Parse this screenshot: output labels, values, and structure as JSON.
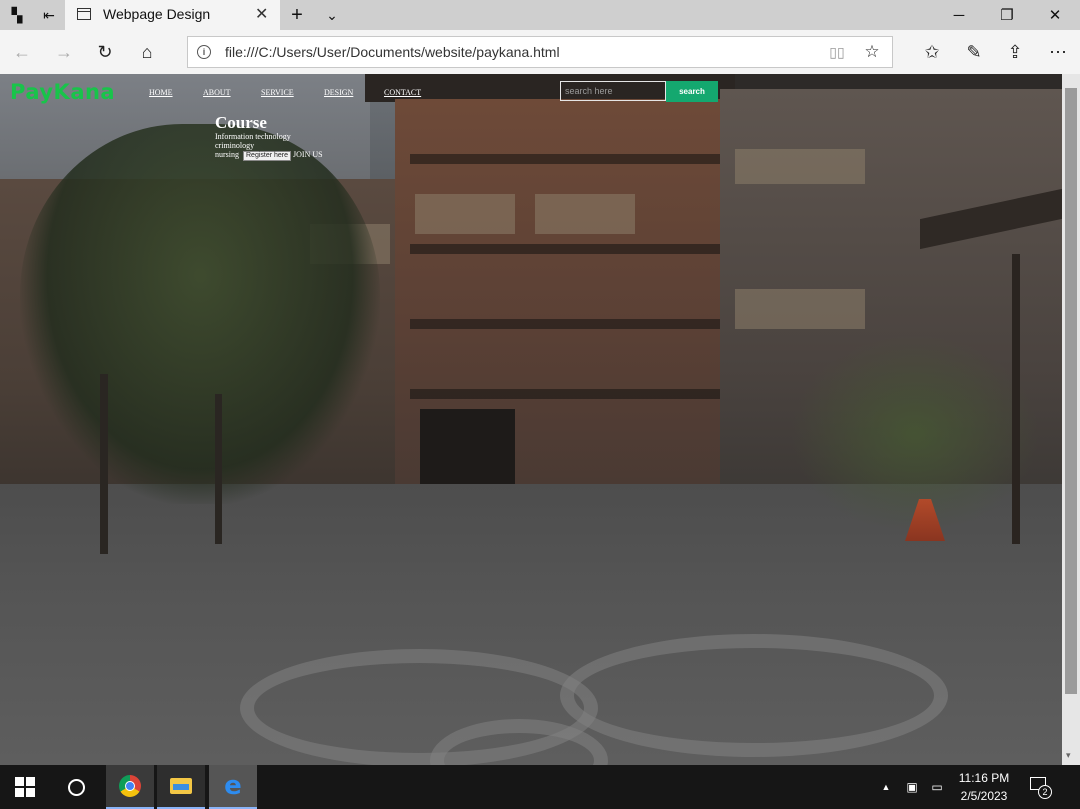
{
  "browser": {
    "tab_title": "Webpage Design",
    "tab_close_glyph": "✕",
    "new_tab_glyph": "+",
    "tab_list_glyph": "⌄",
    "window": {
      "minimize": "─",
      "restore": "❐",
      "close": "✕"
    },
    "url": "file:///C:/Users/User/Documents/website/paykana.html",
    "icons": {
      "tab_strip_left": [
        "tab-preview-icon",
        "set-aside-tabs-icon"
      ],
      "toolbar": [
        "back-icon",
        "forward-icon",
        "refresh-icon",
        "home-icon",
        "info-icon",
        "reading-view-icon",
        "favorite-star-icon",
        "favorites-hub-icon",
        "pen-icon",
        "share-icon",
        "more-icon"
      ]
    }
  },
  "site": {
    "brand": "PayKana",
    "brand_color": "#18c44a",
    "nav": [
      "HOME",
      "ABOUT",
      "SERVICE",
      "DESIGN",
      "CONTACT"
    ],
    "search_placeholder": "search here",
    "search_button": "search",
    "search_button_color": "#14a86f",
    "course": {
      "title": "Course",
      "items": [
        "Information technology",
        "criminology"
      ],
      "last_item": "nursing",
      "register_label": "Register here",
      "join_label": "JOIN US"
    }
  },
  "taskbar": {
    "apps": [
      "chrome-icon",
      "file-explorer-icon",
      "edge-icon"
    ],
    "clock_time": "11:16 PM",
    "clock_date": "2/5/2023",
    "notification_count": "2"
  }
}
